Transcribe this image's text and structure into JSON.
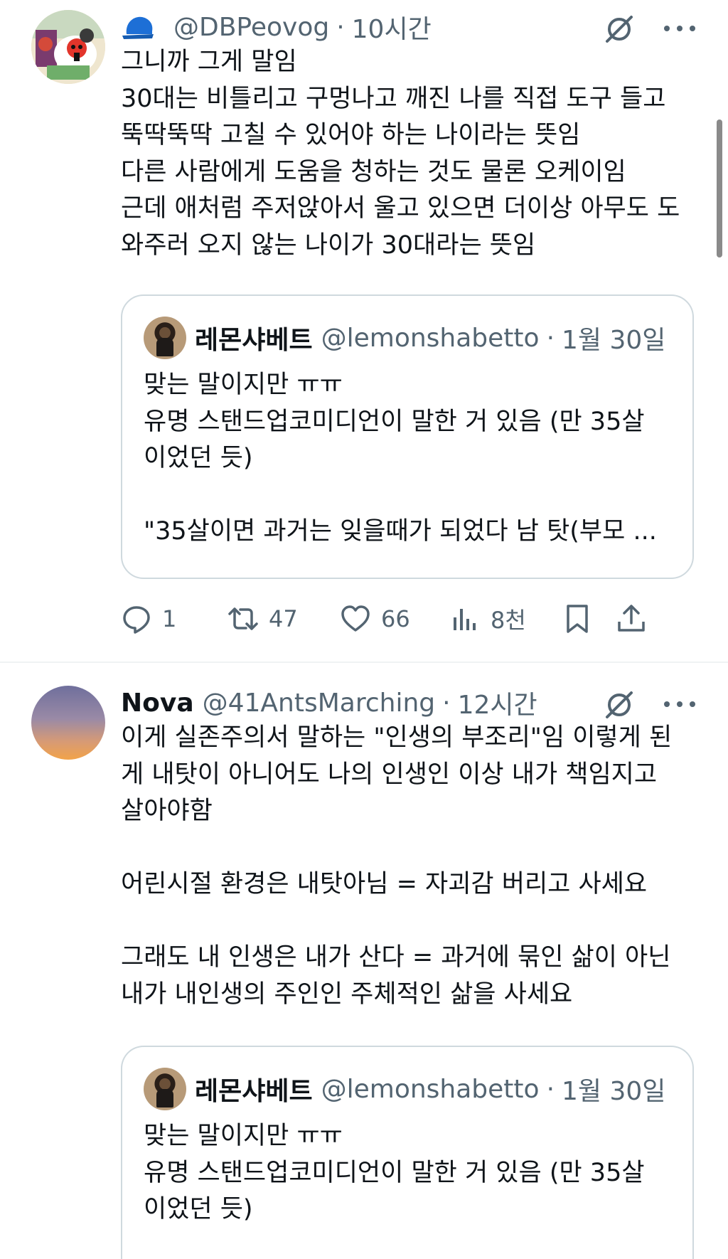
{
  "tweets": [
    {
      "display_name": "",
      "handle": "@DBPeovog",
      "time": "10시간",
      "avatar_icon": "illustrated-character-avatar",
      "badge_icon": "blue-cap-icon",
      "body": [
        "그니까 그게 말임",
        "30대는 비틀리고 구멍나고 깨진 나를 직접 도구 들고",
        "뚝딱뚝딱 고칠 수 있어야 하는 나이라는 뜻임",
        "다른 사람에게 도움을 청하는 것도 물론 오케이임",
        "근데 애처럼 주저앉아서 울고 있으면 더이상 아무도 도",
        "와주러 오지 않는 나이가 30대라는 뜻임"
      ],
      "quote": {
        "display_name": "레몬샤베트",
        "handle": "@lemonshabetto",
        "time": "1월 30일",
        "lines": [
          "맞는 말이지만 ㅠㅠ",
          "유명 스탠드업코미디언이 말한 거 있음 (만 35살",
          "이었던 듯)",
          "",
          "\"35살이면 과거는 잊을때가 되었다 남 탓(부모 ..."
        ]
      },
      "actions": {
        "reply_count": "1",
        "retweet_count": "47",
        "like_count": "66",
        "view_count": "8천"
      }
    },
    {
      "display_name": "Nova",
      "handle": "@41AntsMarching",
      "time": "12시간",
      "avatar_icon": "gradient-avatar",
      "body": [
        "이게 실존주의서 말하는 \"인생의 부조리\"임 이렇게 된",
        "게 내탓이 아니어도 나의 인생인 이상 내가 책임지고",
        "살아야함",
        "",
        "어린시절 환경은 내탓아님 = 자괴감 버리고 사세요",
        "",
        "그래도 내 인생은 내가 산다 = 과거에 묶인 삶이 아닌",
        "내가 내인생의 주인인 주체적인 삶을 사세요"
      ],
      "quote": {
        "display_name": "레몬샤베트",
        "handle": "@lemonshabetto",
        "time": "1월 30일",
        "lines": [
          "맞는 말이지만 ㅠㅠ",
          "유명 스탠드업코미디언이 말한 거 있음 (만 35살",
          "이었던 듯)"
        ]
      }
    }
  ],
  "colors": {
    "text": "#0f1419",
    "secondary": "#536471",
    "border": "#cfd9de",
    "badge_blue": "#1d6fd6"
  }
}
